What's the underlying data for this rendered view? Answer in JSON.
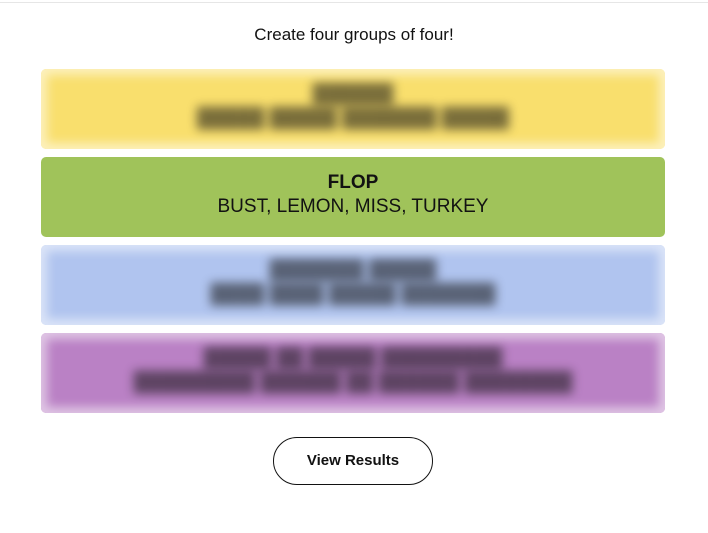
{
  "instructions": "Create four groups of four!",
  "groups": [
    {
      "title": "",
      "members": "",
      "color": "#f9df6d",
      "revealed": false
    },
    {
      "title": "FLOP",
      "members": "BUST, LEMON, MISS, TURKEY",
      "color": "#a0c35a",
      "revealed": true
    },
    {
      "title": "",
      "members": "",
      "color": "#b0c4ef",
      "revealed": false
    },
    {
      "title": "",
      "members": "",
      "color": "#ba81c5",
      "revealed": false
    }
  ],
  "actions": {
    "view_results_label": "View Results"
  }
}
